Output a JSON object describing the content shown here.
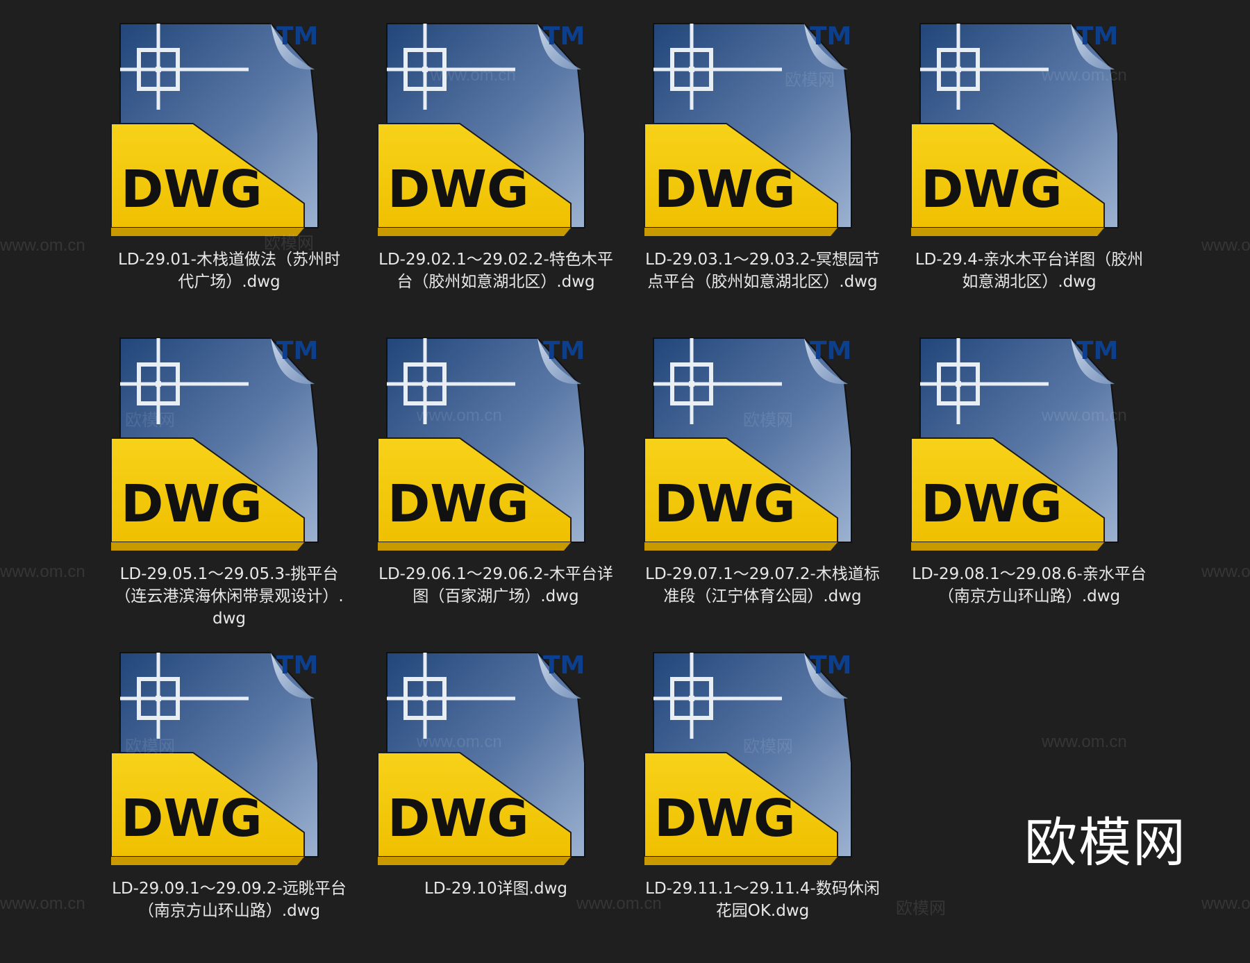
{
  "files": [
    {
      "name": "LD-29.01-木栈道做法（苏州时代广场）.dwg"
    },
    {
      "name": "LD-29.02.1～29.02.2-特色木平台（胶州如意湖北区）.dwg"
    },
    {
      "name": "LD-29.03.1～29.03.2-冥想园节点平台（胶州如意湖北区）.dwg"
    },
    {
      "name": "LD-29.4-亲水木平台详图（胶州如意湖北区）.dwg"
    },
    {
      "name": "LD-29.05.1～29.05.3-挑平台（连云港滨海休闲带景观设计）.dwg"
    },
    {
      "name": "LD-29.06.1～29.06.2-木平台详图（百家湖广场）.dwg"
    },
    {
      "name": "LD-29.07.1～29.07.2-木栈道标准段（江宁体育公园）.dwg"
    },
    {
      "name": "LD-29.08.1～29.08.6-亲水平台（南京方山环山路）.dwg"
    },
    {
      "name": "LD-29.09.1～29.09.2-远眺平台（南京方山环山路）.dwg"
    },
    {
      "name": "LD-29.10详图.dwg"
    },
    {
      "name": "LD-29.11.1～29.11.4-数码休闲花园OK.dwg"
    }
  ],
  "icon": {
    "badge_text": "DWG",
    "tm_text": "TM",
    "semantic": "dwg-file-icon",
    "colors": {
      "blue_dark": "#1a3a6a",
      "blue_light": "#6f8fb8",
      "yellow": "#f2c811",
      "tm": "#0d3f8f"
    }
  },
  "watermark": {
    "logo_text": "欧模网",
    "repeats": [
      "www.om.cn",
      "欧模网"
    ]
  }
}
